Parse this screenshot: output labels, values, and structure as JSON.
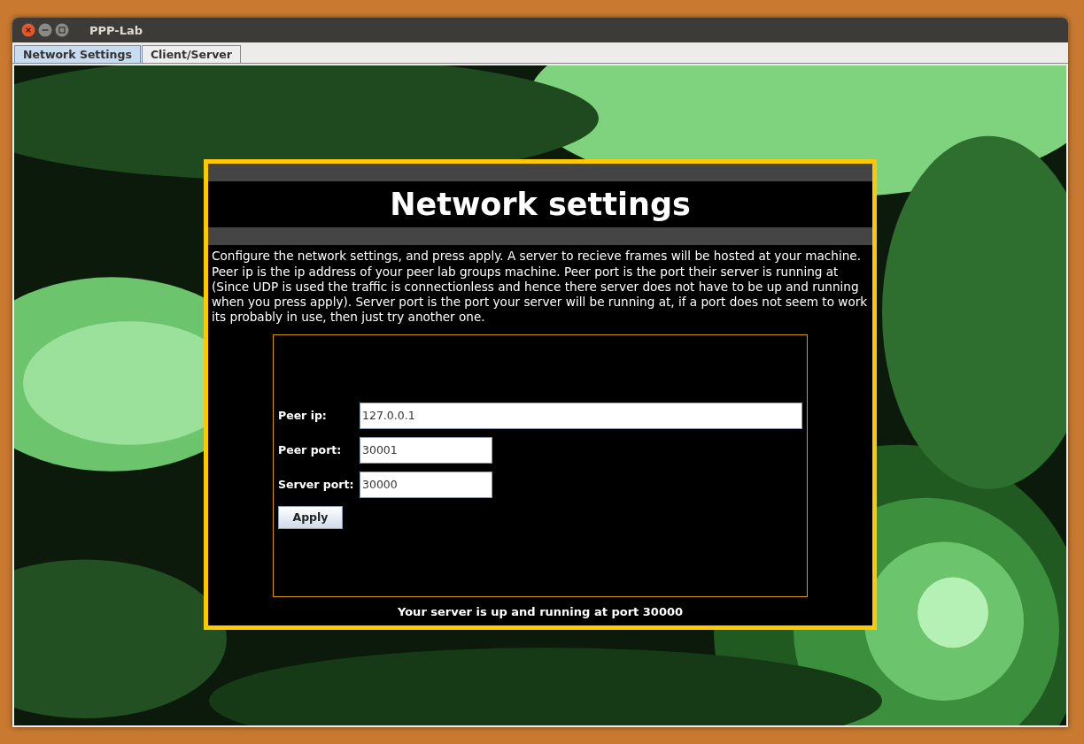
{
  "window": {
    "title": "PPP-Lab"
  },
  "tabs": [
    {
      "label": "Network Settings",
      "selected": true
    },
    {
      "label": "Client/Server",
      "selected": false
    }
  ],
  "panel": {
    "title": "Network settings",
    "description": "Configure the network settings, and press apply. A server to recieve frames will be hosted at your machine. Peer ip is the ip address of your peer lab groups machine. Peer port is the port their server is running at (Since UDP is used the traffic is connectionless and hence there server does not have to be up and running when you press apply). Server port is the port your server will be running at, if a port does not seem to work its probably in use, then just try another one.",
    "fields": [
      {
        "label": "Peer ip:",
        "value": "127.0.0.1",
        "kind": "address"
      },
      {
        "label": "Peer port:",
        "value": "30001",
        "kind": "port"
      },
      {
        "label": "Server port:",
        "value": "30000",
        "kind": "port"
      }
    ],
    "apply_button": "Apply",
    "status": "Your server is up and running at port 30000"
  }
}
